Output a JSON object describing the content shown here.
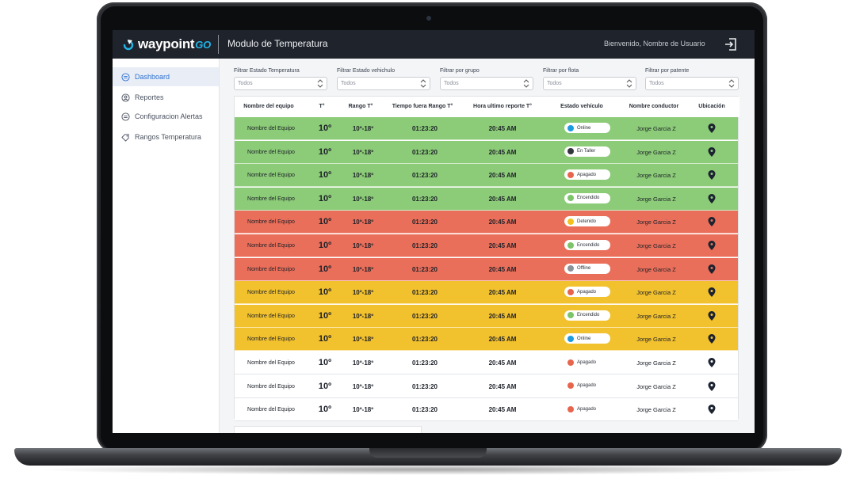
{
  "header": {
    "brand": "waypoint",
    "brand_suffix": "GO",
    "module_title": "Modulo de Temperatura",
    "welcome_text": "Bienvenido, Nombre de Usuario"
  },
  "sidebar": {
    "items": [
      {
        "label": "Dashboard",
        "icon": "dashboard-icon",
        "active": true
      },
      {
        "label": "Reportes",
        "icon": "user-circle-icon",
        "active": false
      },
      {
        "label": "Configuracion Alertas",
        "icon": "list-icon",
        "active": false
      },
      {
        "label": "Rangos Temperatura",
        "icon": "tag-icon",
        "active": false
      }
    ]
  },
  "filters": [
    {
      "label": "Filtrar Estado Temperatura",
      "value": "Todos"
    },
    {
      "label": "Filtrar Estado vehichulo",
      "value": "Todos"
    },
    {
      "label": "Filtrar por grupo",
      "value": "Todos"
    },
    {
      "label": "Filtrar por flota",
      "value": "Todos"
    },
    {
      "label": "Filtrar por patente",
      "value": "Todos"
    }
  ],
  "table": {
    "columns": [
      "Nombre del equipo",
      "T°",
      "Rango  T°",
      "Tiempo fuera Rango T°",
      "Hora ultimo reporte  T°",
      "Estado vehículo",
      "Nombre conductor",
      "Ubicación"
    ],
    "rows": [
      {
        "row_status": "green",
        "equipo": "Nombre del Equipo",
        "temp": "10º",
        "rango": "10º-18º",
        "tiempo": "01:23:20",
        "hora": "20:45 AM",
        "estado": "Online",
        "estado_color": "#1e9be0",
        "conductor": "Jorge Garcia Z"
      },
      {
        "row_status": "green",
        "equipo": "Nombre del Equipo",
        "temp": "10º",
        "rango": "10º-18º",
        "tiempo": "01:23:20",
        "hora": "20:45 AM",
        "estado": "En Taller",
        "estado_color": "#33363d",
        "conductor": "Jorge Garcia Z"
      },
      {
        "row_status": "green",
        "equipo": "Nombre del Equipo",
        "temp": "10º",
        "rango": "10º-18º",
        "tiempo": "01:23:20",
        "hora": "20:45 AM",
        "estado": "Apagado",
        "estado_color": "#e8654d",
        "conductor": "Jorge Garcia Z"
      },
      {
        "row_status": "green",
        "equipo": "Nombre del Equipo",
        "temp": "10º",
        "rango": "10º-18º",
        "tiempo": "01:23:20",
        "hora": "20:45 AM",
        "estado": "Encendido",
        "estado_color": "#7cc46a",
        "conductor": "Jorge Garcia Z"
      },
      {
        "row_status": "red",
        "equipo": "Nombre del Equipo",
        "temp": "10º",
        "rango": "10º-18º",
        "tiempo": "01:23:20",
        "hora": "20:45 AM",
        "estado": "Detenido",
        "estado_color": "#f4c21f",
        "conductor": "Jorge Garcia Z"
      },
      {
        "row_status": "red",
        "equipo": "Nombre del Equipo",
        "temp": "10º",
        "rango": "10º-18º",
        "tiempo": "01:23:20",
        "hora": "20:45 AM",
        "estado": "Encendido",
        "estado_color": "#7cc46a",
        "conductor": "Jorge Garcia Z"
      },
      {
        "row_status": "red",
        "equipo": "Nombre del Equipo",
        "temp": "10º",
        "rango": "10º-18º",
        "tiempo": "01:23:20",
        "hora": "20:45 AM",
        "estado": "Offline",
        "estado_color": "#8c9098",
        "conductor": "Jorge Garcia Z"
      },
      {
        "row_status": "yellow",
        "equipo": "Nombre del Equipo",
        "temp": "10º",
        "rango": "10º-18º",
        "tiempo": "01:23:20",
        "hora": "20:45 AM",
        "estado": "Apagado",
        "estado_color": "#e8654d",
        "conductor": "Jorge Garcia Z"
      },
      {
        "row_status": "yellow",
        "equipo": "Nombre del Equipo",
        "temp": "10º",
        "rango": "10º-18º",
        "tiempo": "01:23:20",
        "hora": "20:45 AM",
        "estado": "Encendido",
        "estado_color": "#7cc46a",
        "conductor": "Jorge Garcia Z"
      },
      {
        "row_status": "yellow",
        "equipo": "Nombre del Equipo",
        "temp": "10º",
        "rango": "10º-18º",
        "tiempo": "01:23:20",
        "hora": "20:45 AM",
        "estado": "Online",
        "estado_color": "#1e9be0",
        "conductor": "Jorge Garcia Z"
      },
      {
        "row_status": "white",
        "equipo": "Nombre del Equipo",
        "temp": "10º",
        "rango": "10º-18º",
        "tiempo": "01:23:20",
        "hora": "20:45 AM",
        "estado": "Apagado",
        "estado_color": "#e8654d",
        "conductor": "Jorge Garcia Z"
      },
      {
        "row_status": "white",
        "equipo": "Nombre del Equipo",
        "temp": "10º",
        "rango": "10º-18º",
        "tiempo": "01:23:20",
        "hora": "20:45 AM",
        "estado": "Apagado",
        "estado_color": "#e8654d",
        "conductor": "Jorge Garcia Z"
      },
      {
        "row_status": "white",
        "equipo": "Nombre del Equipo",
        "temp": "10º",
        "rango": "10º-18º",
        "tiempo": "01:23:20",
        "hora": "20:45 AM",
        "estado": "Apagado",
        "estado_color": "#e8654d",
        "conductor": "Jorge Garcia Z"
      }
    ]
  },
  "colors": {
    "topbar": "#1f232b",
    "accent": "#21b5e8",
    "row_green": "#8ccb78",
    "row_red": "#ea6f5a",
    "row_yellow": "#f2c12e",
    "active_link": "#2b6fd1"
  }
}
